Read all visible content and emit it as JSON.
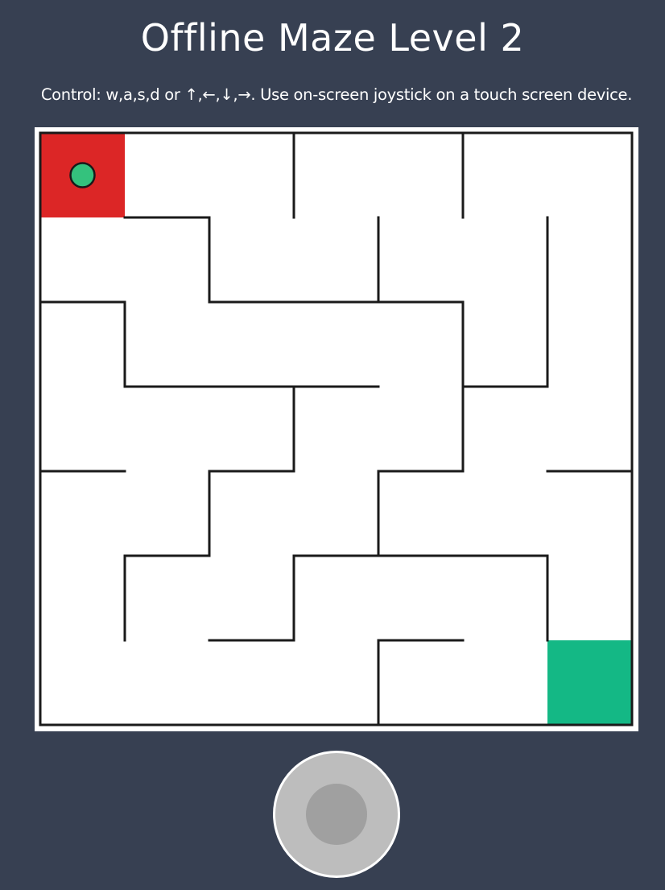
{
  "header": {
    "title": "Offline Maze Level 2",
    "instructions": "Control: w,a,s,d or ↑,←,↓,→. Use on-screen joystick on a touch screen device."
  },
  "maze": {
    "level": 2,
    "grid_size": 7,
    "colors": {
      "start_cell": "#dc2626",
      "goal_cell": "#14b885",
      "player": "#34c27d",
      "wall": "#1a1a1a",
      "background": "#ffffff"
    },
    "start_cell": [
      0,
      0
    ],
    "goal_cell": [
      6,
      6
    ],
    "player_cell": [
      0,
      0
    ],
    "walls": [
      [
        0,
        0,
        7,
        0
      ],
      [
        0,
        7,
        7,
        7
      ],
      [
        0,
        0,
        0,
        7
      ],
      [
        7,
        0,
        7,
        7
      ],
      [
        1,
        1,
        2,
        1
      ],
      [
        2,
        1,
        2,
        2
      ],
      [
        2,
        2,
        5,
        2
      ],
      [
        3,
        0,
        3,
        1
      ],
      [
        5,
        0,
        5,
        1
      ],
      [
        4,
        1,
        4,
        2
      ],
      [
        6,
        1,
        6,
        3
      ],
      [
        0,
        2,
        1,
        2
      ],
      [
        1,
        2,
        1,
        3
      ],
      [
        1,
        3,
        4,
        3
      ],
      [
        5,
        2,
        5,
        4
      ],
      [
        5,
        3,
        6,
        3
      ],
      [
        3,
        3,
        3,
        4
      ],
      [
        2,
        4,
        3,
        4
      ],
      [
        0,
        4,
        1,
        4
      ],
      [
        6,
        4,
        7,
        4
      ],
      [
        4,
        4,
        5,
        4
      ],
      [
        4,
        4,
        4,
        5
      ],
      [
        2,
        4,
        2,
        5
      ],
      [
        1,
        5,
        2,
        5
      ],
      [
        1,
        5,
        1,
        6
      ],
      [
        3,
        5,
        6,
        5
      ],
      [
        3,
        5,
        3,
        6
      ],
      [
        6,
        5,
        6,
        6
      ],
      [
        2,
        6,
        3,
        6
      ],
      [
        4,
        6,
        5,
        6
      ],
      [
        4,
        6,
        4,
        7
      ]
    ]
  },
  "joystick": {
    "label": "joystick"
  }
}
